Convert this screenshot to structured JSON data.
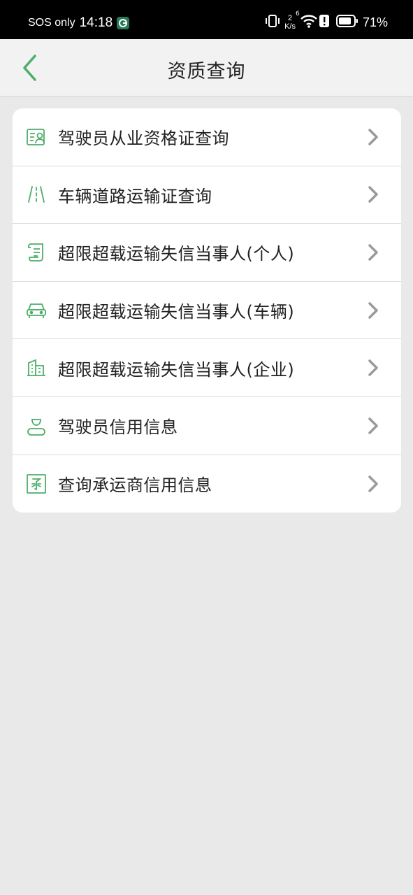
{
  "statusbar": {
    "carrier": "SOS only",
    "time": "14:18",
    "speed_value": "2",
    "speed_unit": "K/s",
    "network_label": "6",
    "battery": "71%"
  },
  "header": {
    "title": "资质查询"
  },
  "colors": {
    "accent": "#4cae6a",
    "chevron": "#9a9a9a"
  },
  "menu": {
    "items": [
      {
        "label": "驾驶员从业资格证查询",
        "icon": "id-card-icon"
      },
      {
        "label": "车辆道路运输证查询",
        "icon": "road-icon"
      },
      {
        "label": "超限超载运输失信当事人(个人)",
        "icon": "scroll-document-icon"
      },
      {
        "label": "超限超载运输失信当事人(车辆)",
        "icon": "car-icon"
      },
      {
        "label": "超限超载运输失信当事人(企业)",
        "icon": "building-icon"
      },
      {
        "label": "驾驶员信用信息",
        "icon": "driver-person-icon"
      },
      {
        "label": "查询承运商信用信息",
        "icon": "carrier-stamp-icon"
      }
    ]
  }
}
